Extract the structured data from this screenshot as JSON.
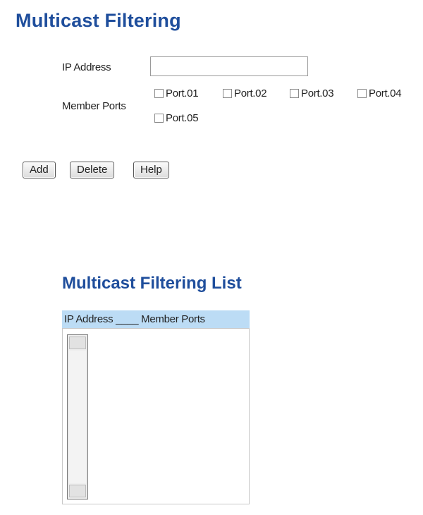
{
  "page": {
    "title": "Multicast Filtering"
  },
  "form": {
    "ip_label": "IP Address",
    "ip_value": "",
    "member_label": "Member Ports",
    "ports": [
      {
        "label": "Port.01",
        "checked": false
      },
      {
        "label": "Port.02",
        "checked": false
      },
      {
        "label": "Port.03",
        "checked": false
      },
      {
        "label": "Port.04",
        "checked": false
      },
      {
        "label": "Port.05",
        "checked": false
      }
    ]
  },
  "buttons": {
    "add": "Add",
    "delete": "Delete",
    "help": "Help"
  },
  "list": {
    "title": "Multicast Filtering List",
    "header": "IP Address ____ Member Ports",
    "items": []
  }
}
